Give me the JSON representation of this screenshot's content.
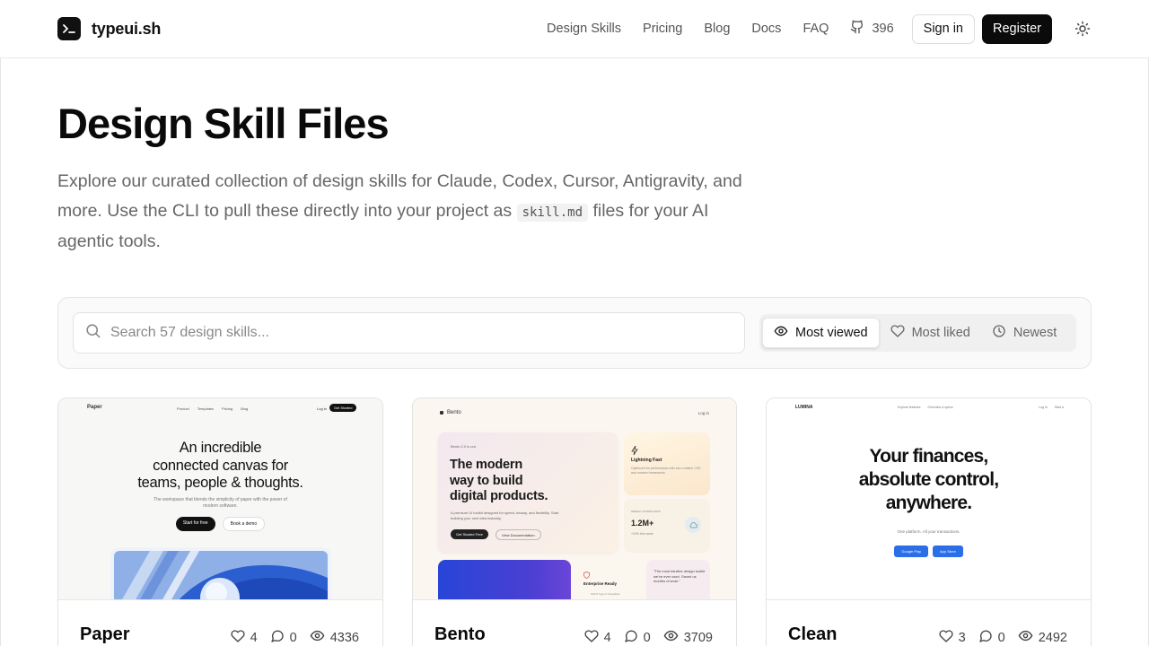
{
  "header": {
    "logo_text": "typeui.sh",
    "nav": [
      "Design Skills",
      "Pricing",
      "Blog",
      "Docs",
      "FAQ"
    ],
    "github_stars": "396",
    "sign_in": "Sign in",
    "register": "Register"
  },
  "hero": {
    "title": "Design Skill Files",
    "desc_before": "Explore our curated collection of design skills for Claude, Codex, Cursor, Antigravity, and more. Use the CLI to pull these directly into your project as",
    "desc_code": "skill.md",
    "desc_after": "files for your AI agentic tools."
  },
  "search": {
    "placeholder": "Search 57 design skills..."
  },
  "sort": {
    "options": [
      "Most viewed",
      "Most liked",
      "Newest"
    ],
    "active": "Most viewed"
  },
  "cards": [
    {
      "name": "Paper",
      "likes": "4",
      "comments": "0",
      "views": "4336",
      "preview": {
        "logo": "Paper",
        "links": [
          "Product",
          "Templates",
          "Pricing",
          "Blog"
        ],
        "login": "Log in",
        "cta": "Get Started",
        "headline_1": "An incredible",
        "headline_2": "connected canvas for",
        "headline_3": "teams, people & thoughts.",
        "sub_1": "The workspace that blends the simplicity of paper with the power of",
        "sub_2": "modern software.",
        "btn_1": "Start for free",
        "btn_2": "Book a demo"
      }
    },
    {
      "name": "Bento",
      "likes": "4",
      "comments": "0",
      "views": "3709",
      "preview": {
        "logo": "Bento",
        "login": "Log in",
        "tag": "Bento 2.0 is out",
        "title_1": "The modern",
        "title_2": "way to build",
        "title_3": "digital products.",
        "sub": "A premium UI toolkit designed for speed, beauty, and flexibility. Start building your next idea instantly.",
        "btn_1": "Get Started Free",
        "btn_2": "View Documentation",
        "card_1_title": "Lightning Fast",
        "card_1_sub": "Optimized for performance with zero-runtime CSS and modern frameworks.",
        "stat_label": "WEEKLY DOWNLOADS",
        "stat_value": "1.2M+",
        "stat_delta": "+24% this week",
        "ent_title": "Enterprise Ready",
        "ent_sub": "SOC2 Type II Compliant",
        "quote": "\"The most intuitive design toolkit we've ever used. Saved us months of work.\""
      }
    },
    {
      "name": "Clean",
      "likes": "3",
      "comments": "0",
      "views": "2492",
      "preview": {
        "logo": "LUMINA",
        "links": [
          "Explore features",
          "Overview & specs"
        ],
        "right": [
          "Log in",
          "Start a"
        ],
        "headline_1": "Your finances,",
        "headline_2": "absolute control,",
        "headline_3": "anywhere.",
        "sub": "One platform. All your transactions.",
        "btn_1": "Google Play",
        "btn_2": "App Store"
      }
    }
  ],
  "colors": {
    "accent": "#0b0b0b",
    "muted": "#666666",
    "border": "#e5e5e5",
    "blue": "#2a6ee8"
  }
}
